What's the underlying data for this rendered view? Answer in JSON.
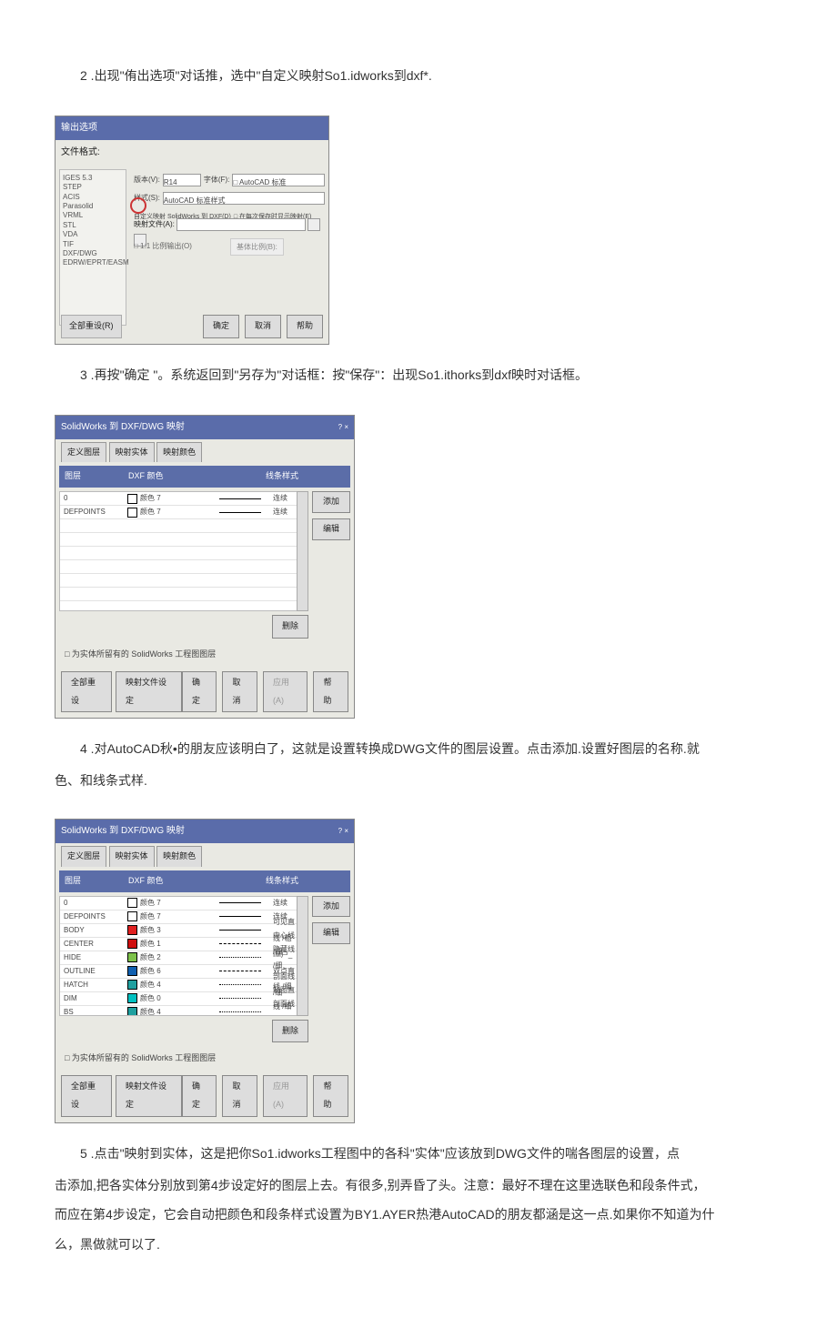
{
  "step2": "2 .出现\"侑出选项\"对话推，选中\"自定义映射So1.idworks到dxf*.",
  "step3": "3 .再按\"确定 \"。系统返回到\"另存为\"对话框：按\"保存\"：出现So1.ithorks到dxf映时对话框。",
  "step4a": "4 .对AutoCAD秋•的朋友应该明白了，这就是设置转换成DWG文件的图层设置。点击添加.设置好图层的名称.就",
  "step4b": "色、和线条式样.",
  "step5a": "5 .点击\"映射到实体，这是把你So1.idworks工程图中的各科\"实体\"应该放到DWG文件的喘各图层的设置，点",
  "step5b": "击添加,把各实体分别放到第4步设定好的图层上去。有很多,别弄昏了头。注意：最好不理在这里选联色和段条件式，",
  "step5c": "而应在第4步设定，它会自动把颜色和段条样式设置为BY1.AYER热港AutoCAD的朋友都涵是这一点.如果你不知道为什",
  "step5d": "么，黑做就可以了.",
  "dlg1": {
    "title": "输出选项",
    "fileformat": "文件格式:",
    "formats": [
      "IGES 5.3",
      "STEP",
      "ACIS",
      "Parasolid",
      "VRML",
      "STL",
      "VDA",
      "TIF",
      "DXF/DWG",
      "EDRW/EPRT/EASM"
    ],
    "row_ver": "版本(V):",
    "ver_val": "R14",
    "row_font": "字体(F):",
    "font_val": "□ AutoCAD 标准",
    "row_style": "样式(S):",
    "style_val": "AutoCAD 标准样式",
    "map_opt": "自定义映射 SolidWorks 到 DXF(D)",
    "map_opt2": "□ 在每次保存时显示映射(E)",
    "file_lbl": "映射文件(A):",
    "chk_scale": "□ 1:1 比例输出(O)",
    "chk_base": "基体比例(B):",
    "reset": "全部重设(R)",
    "ok": "确定",
    "cancel": "取消",
    "help": "帮助"
  },
  "dlg2": {
    "title": "SolidWorks 到 DXF/DWG 映射",
    "tab1": "定义图层",
    "tab2": "映射实体",
    "tab3": "映射颜色",
    "h_layer": "图层",
    "h_color": "DXF 颜色",
    "h_line": "线条样式",
    "rows": [
      {
        "layer": "0",
        "color": "颜色 7",
        "swatch": "#ffffff",
        "line": "连续",
        "type": "solid"
      },
      {
        "layer": "DEFPOINTS",
        "color": "颜色 7",
        "swatch": "#ffffff",
        "line": "连续",
        "type": "solid"
      }
    ],
    "btn_add": "添加",
    "btn_edit": "编辑",
    "btn_del": "删除",
    "chk": "□ 为实体所留有的 SolidWorks 工程图图层",
    "f_reset": "全部重设",
    "f_map": "映射文件设定",
    "f_ok": "确定",
    "f_cancel": "取消",
    "f_apply": "应用(A)",
    "f_help": "帮助"
  },
  "dlg3": {
    "title": "SolidWorks 到 DXF/DWG 映射",
    "tab1": "定义图层",
    "tab2": "映射实体",
    "tab3": "映射颜色",
    "h_layer": "图层",
    "h_color": "DXF 颜色",
    "h_line": "线条样式",
    "rows": [
      {
        "layer": "0",
        "color": "颜色 7",
        "swatch": "#ffffff",
        "line": "连续",
        "type": "solid"
      },
      {
        "layer": "DEFPOINTS",
        "color": "颜色 7",
        "swatch": "#ffffff",
        "line": "连续",
        "type": "solid"
      },
      {
        "layer": "BODY",
        "color": "颜色 3",
        "swatch": "#e02020",
        "line": "可见直线 /粗",
        "type": "solid"
      },
      {
        "layer": "CENTER",
        "color": "颜色 1",
        "swatch": "#d01010",
        "line": "中心线 /细",
        "type": "dash"
      },
      {
        "layer": "HIDE",
        "color": "颜色 2",
        "swatch": "#7dc24a",
        "line": "隐藏线 /细",
        "type": "dot"
      },
      {
        "layer": "OUTLINE",
        "color": "颜色 6",
        "swatch": "#1060b0",
        "line": "IM户_双点直线 /细",
        "type": "dash"
      },
      {
        "layer": "HATCH",
        "color": "颜色 4",
        "swatch": "#20a0a0",
        "line": "剖面线 /细",
        "type": "dot"
      },
      {
        "layer": "DIM",
        "color": "颜色 0",
        "swatch": "#00c0c0",
        "line": "制图直线 /细",
        "type": "dot"
      },
      {
        "layer": "BS",
        "color": "颜色 4",
        "swatch": "#20a0a0",
        "line": "剖面线 /细",
        "type": "dot"
      }
    ],
    "btn_add": "添加",
    "btn_edit": "编辑",
    "btn_del": "删除",
    "chk": "□ 为实体所留有的 SolidWorks 工程图图层",
    "f_reset": "全部重设",
    "f_map": "映射文件设定",
    "f_ok": "确定",
    "f_cancel": "取消",
    "f_apply": "应用(A)",
    "f_help": "帮助"
  }
}
